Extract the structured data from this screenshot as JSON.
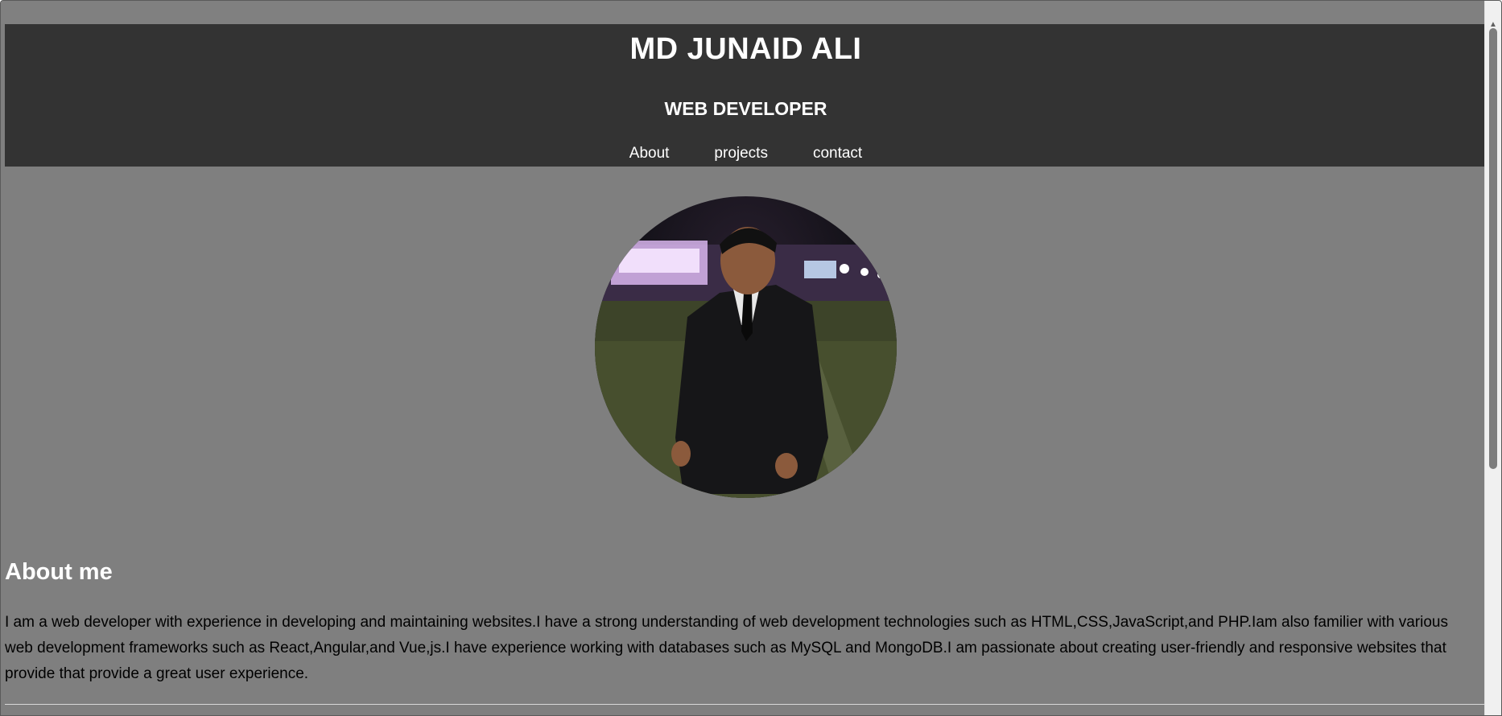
{
  "header": {
    "title": "MD JUNAID ALI",
    "subtitle": "WEB DEVELOPER",
    "nav": [
      {
        "label": "About"
      },
      {
        "label": "projects"
      },
      {
        "label": "contact"
      }
    ]
  },
  "about": {
    "heading": "About me",
    "text": "I am a web developer with experience in developing and maintaining websites.I have a strong understanding of web development technologies such as HTML,CSS,JavaScript,and PHP.Iam also familier with various web development frameworks such as React,Angular,and Vue,js.I have experience working with databases such as MySQL and MongoDB.I am passionate about creating user-friendly and responsive websites that provide that provide a great user experience."
  },
  "colors": {
    "page_background": "#7f7f7f",
    "header_background": "#333333",
    "heading_text": "#ffffff",
    "body_text": "#000000"
  },
  "icons": {
    "scroll_up": "chevron-up-icon"
  }
}
